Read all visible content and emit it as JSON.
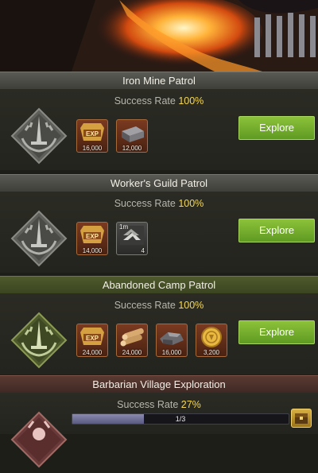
{
  "missions": [
    {
      "title": "Iron Mine Patrol",
      "rate_label": "Success Rate",
      "rate_value": "100%",
      "rewards": [
        {
          "icon": "exp-icon",
          "qty": "16,000"
        },
        {
          "icon": "iron-ingot-icon",
          "qty": "12,000"
        }
      ],
      "button": "Explore"
    },
    {
      "title": "Worker's Guild Patrol",
      "rate_label": "Success Rate",
      "rate_value": "100%",
      "rewards": [
        {
          "icon": "exp-icon",
          "qty": "14,000"
        },
        {
          "icon": "speedup-icon",
          "qty": "4",
          "badge": "1m"
        }
      ],
      "button": "Explore"
    },
    {
      "title": "Abandoned Camp Patrol",
      "rate_label": "Success Rate",
      "rate_value": "100%",
      "rewards": [
        {
          "icon": "exp-icon",
          "qty": "24,000"
        },
        {
          "icon": "wood-logs-icon",
          "qty": "24,000"
        },
        {
          "icon": "iron-ore-icon",
          "qty": "16,000"
        },
        {
          "icon": "gold-coin-icon",
          "qty": "3,200"
        }
      ],
      "button": "Explore"
    },
    {
      "title": "Barbarian Village Exploration",
      "rate_label": "Success Rate",
      "rate_value": "27%",
      "progress": {
        "text": "1/3",
        "fraction": 0.33
      }
    }
  ],
  "exp_label": "EXP",
  "colors": {
    "accent_yellow": "#f6d84f",
    "button_green": "#7ab432"
  }
}
